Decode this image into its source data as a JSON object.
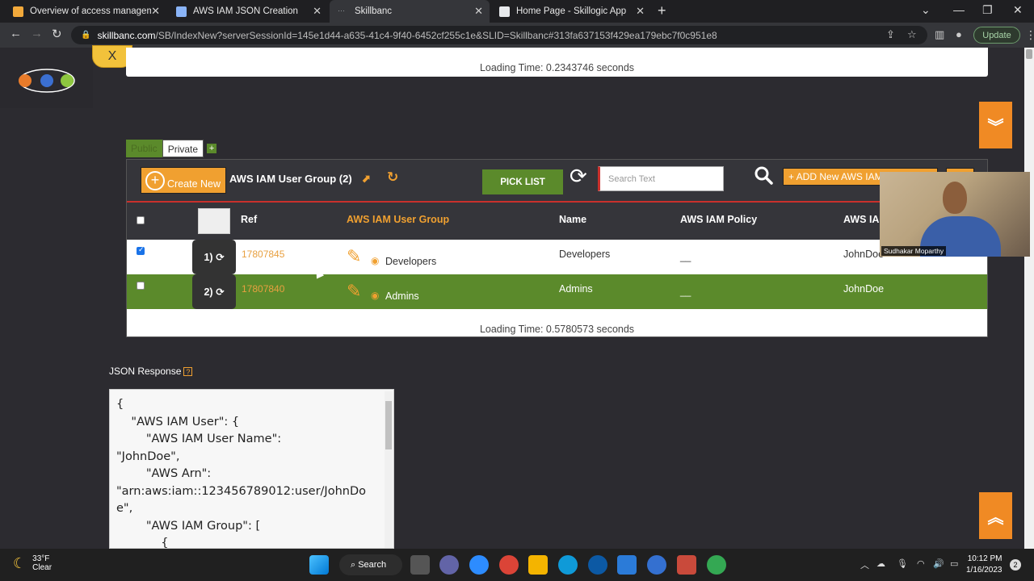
{
  "browser": {
    "tabs": [
      {
        "label": "Overview of access management:",
        "icon_color": "#f2a93b"
      },
      {
        "label": "AWS IAM JSON Creation",
        "icon_color": "#8ab4f8"
      },
      {
        "label": "Skillbanc",
        "icon_color": "#9aa0a6"
      },
      {
        "label": "Home Page - Skillogic App",
        "icon_color": "#e8eaed"
      }
    ],
    "url_host": "skillbanc.com",
    "url_path": "/SB/IndexNew?serverSessionId=145e1d44-a635-41c4-9f40-6452cf255c1e&SLID=Skillbanc#313fa637153f429ea179ebc7f0c951e8",
    "update_label": "Update"
  },
  "app": {
    "close_label": "X",
    "loading_top": "Loading Time: 0.2343746 seconds",
    "loading_bottom": "Loading Time: 0.5780573 seconds",
    "scope_tabs": {
      "public": "Public",
      "private": "Private",
      "add": "+"
    },
    "grid": {
      "create_label": "Create New",
      "title": "AWS IAM User Group (2)",
      "picklist_label": "PICK LIST",
      "search_placeholder": "Search Text",
      "add_new_label": "+ ADD New AWS IAM User Group",
      "columns": {
        "ref": "Ref",
        "group": "AWS IAM User Group",
        "name": "Name",
        "policy": "AWS IAM Policy",
        "user": "AWS IAM User"
      },
      "rows": [
        {
          "num": "1)",
          "ref": "17807845",
          "group": "Developers",
          "name": "Developers",
          "policy": "__",
          "user": "JohnDoe"
        },
        {
          "num": "2)",
          "ref": "17807840",
          "group": "Admins",
          "name": "Admins",
          "policy": "__",
          "user": "JohnDoe"
        }
      ]
    },
    "json_label": "JSON Response",
    "json_help": "?",
    "json_text": "{\n    \"AWS IAM User\": {\n        \"AWS IAM User Name\":\n\"JohnDoe\",\n        \"AWS Arn\":\n\"arn:aws:iam::123456789012:user/JohnDo\ne\",\n        \"AWS IAM Group\": [\n            {"
  },
  "video": {
    "name": "Sudhakar Moparthy"
  },
  "taskbar": {
    "temp": "33°F",
    "condition": "Clear",
    "search_label": "Search",
    "time": "10:12 PM",
    "date": "1/16/2023",
    "notifications": "2"
  },
  "colors": {
    "accent_orange": "#f0a030",
    "accent_green": "#5b8a2b",
    "header_dark": "#35353a"
  }
}
